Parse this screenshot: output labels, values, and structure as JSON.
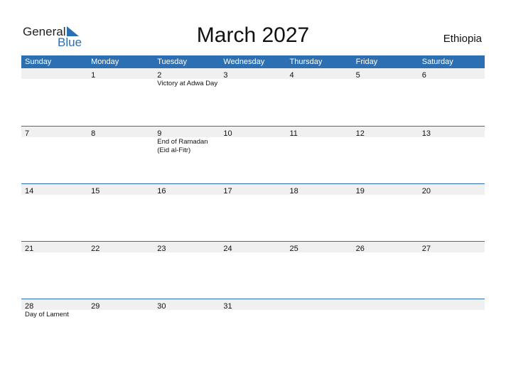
{
  "logo": {
    "general": "General",
    "blue": "Blue"
  },
  "title": "March 2027",
  "country": "Ethiopia",
  "colors": {
    "accent": "#2c70b3",
    "dayrow": "#f0f0f0"
  },
  "weekdays": [
    "Sunday",
    "Monday",
    "Tuesday",
    "Wednesday",
    "Thursday",
    "Friday",
    "Saturday"
  ],
  "weeks": [
    [
      {
        "d": ""
      },
      {
        "d": "1"
      },
      {
        "d": "2",
        "e": "Victory at Adwa Day"
      },
      {
        "d": "3"
      },
      {
        "d": "4"
      },
      {
        "d": "5"
      },
      {
        "d": "6"
      }
    ],
    [
      {
        "d": "7"
      },
      {
        "d": "8"
      },
      {
        "d": "9",
        "e": "End of Ramadan (Eid al-Fitr)"
      },
      {
        "d": "10"
      },
      {
        "d": "11"
      },
      {
        "d": "12"
      },
      {
        "d": "13"
      }
    ],
    [
      {
        "d": "14"
      },
      {
        "d": "15"
      },
      {
        "d": "16"
      },
      {
        "d": "17"
      },
      {
        "d": "18"
      },
      {
        "d": "19"
      },
      {
        "d": "20"
      }
    ],
    [
      {
        "d": "21"
      },
      {
        "d": "22"
      },
      {
        "d": "23"
      },
      {
        "d": "24"
      },
      {
        "d": "25"
      },
      {
        "d": "26"
      },
      {
        "d": "27"
      }
    ],
    [
      {
        "d": "28",
        "e": "Day of Lament"
      },
      {
        "d": "29"
      },
      {
        "d": "30"
      },
      {
        "d": "31"
      },
      {
        "d": ""
      },
      {
        "d": ""
      },
      {
        "d": ""
      }
    ]
  ]
}
